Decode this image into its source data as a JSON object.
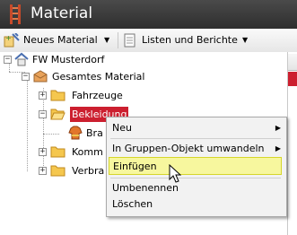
{
  "window": {
    "title": "Material"
  },
  "toolbar": {
    "new_material": "Neues Material",
    "lists_reports": "Listen und Berichte"
  },
  "tree": {
    "root": "FW Musterdorf",
    "total": "Gesamtes Material",
    "vehicles": "Fahrzeuge",
    "clothing": "Bekleidung",
    "brand_partial": "Bra",
    "comm_partial": "Komm",
    "consumables_partial": "Verbra"
  },
  "context_menu": {
    "new": "Neu",
    "convert_group": "In Gruppen-Objekt umwandeln",
    "paste": "Einfügen",
    "rename": "Umbenennen",
    "delete": "Löschen"
  },
  "colors": {
    "accent": "#cc1f2f",
    "highlight": "#f7f79e"
  }
}
